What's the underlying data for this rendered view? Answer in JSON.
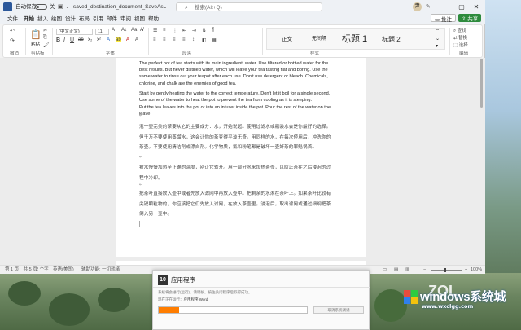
{
  "titlebar": {
    "autosave_label": "自动保存",
    "toggle_state": "关",
    "doc_name": "saved_destination_document_SaveAs",
    "search_placeholder": "搜索(Alt+Q)",
    "avatar_initial": "尹"
  },
  "menu": {
    "tabs": [
      "文件",
      "开始",
      "插入",
      "绘图",
      "设计",
      "布局",
      "引用",
      "邮件",
      "审阅",
      "视图",
      "帮助"
    ],
    "active_tab": "开始",
    "comments_label": "批注",
    "share_label": "共享"
  },
  "ribbon": {
    "groups": [
      "撤消",
      "剪贴板",
      "字体",
      "段落",
      "样式",
      "编辑"
    ],
    "paste_label": "粘贴",
    "font_name": "(中文正文)",
    "font_size": "11",
    "styles": [
      "正文",
      "无间隔",
      "标题 1",
      "标题 2"
    ],
    "edit_items": [
      "查找",
      "替换",
      "选择"
    ]
  },
  "document": {
    "english_paragraphs": [
      "The perfect pot of tea starts with its main ingredient, water. Use filtered or bottled water for the best results. But never distilled water, which will leave your tea tasting flat and boring. Use the same water to rinse out your teapot after each use. Don't use detergent or bleach. Chemicals, chlorine, and chalk are the enemies of good tea.",
      "Start by gently heating the water to the correct temperature. Don't let it boil for a single second. Use some of the water to heat the pot to prevent the tea from cooling as it is steeping.",
      "Put the tea leaves into the pot or into an infuser inside the pot. Pour the rest of the water on the leave"
    ],
    "chinese_paragraphs": [
      "泡一壶完美的茶要从它的主要成分：水，开始说起。使用过滤水或瓶装水会是你最好的选择。但千万不要使用蒸馏水，这会让你的茶变得平淡无奇。用同样的水，在每次使用后，冲洗你的茶壶。不要使用清洁剂或漂白剂。化学物质，氯和粉笔都是破坏一壶好茶的罪魁祸首。",
      "被水慢慢加热至正确的温度，别让它煮开。用一部分水来加热茶壶，以防止茶在之后浸泡的过程中冷却。",
      "把茶叶直接放入壶中或者先放入滤网中再放入壶中。把剩余的水淋在茶叶上。如果茶叶比较有尖锐颗粒物的，你应该把它们先放入滤网，在放入茶壶里。浸泡后，取出滤网或通过细纲把茶倒入另一壶中。"
    ],
    "para_mark": "↵"
  },
  "statusbar": {
    "page": "第 1 页，共 5 页",
    "words": "2 个字",
    "language": "英语(美国)",
    "accessibility": "辅助功能: 一切就绪",
    "zoom": "100%"
  },
  "dialog": {
    "logo": "10",
    "title": "应用程序",
    "message": "系统将会进行(运行)，请稍候，按住关闭程序后取得成功。",
    "status_prefix": "现在正在运行：",
    "status_value": "应用程序 Word",
    "progress": 0.14,
    "cancel_label": "取消系统调试"
  },
  "watermark": {
    "brand": "windows系统城",
    "url": "www.wxclgg.com",
    "corner": "ZOL"
  },
  "colors": {
    "accent": "#2b579a",
    "share_button": "#2e8b3d",
    "progress_fill": "#ff7d00"
  }
}
